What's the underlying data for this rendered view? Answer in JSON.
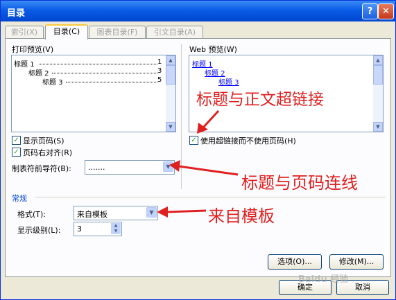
{
  "window": {
    "title": "目录",
    "help": "?",
    "close": "✕"
  },
  "tabs": [
    {
      "label": "索引(X)"
    },
    {
      "label": "目录(C)"
    },
    {
      "label": "图表目录(F)"
    },
    {
      "label": "引文目录(A)"
    }
  ],
  "print_preview": {
    "label": "打印预览(V)",
    "lines": [
      "标题 1",
      "标题 2",
      "标题 3"
    ],
    "pages": [
      "1",
      "3",
      "5"
    ]
  },
  "web_preview": {
    "label": "Web 预览(W)",
    "links": [
      "标题 1",
      "标题 2",
      "标题 3"
    ]
  },
  "options": {
    "show_page_numbers": "显示页码(S)",
    "right_align": "页码右对齐(R)",
    "tab_leader_label": "制表符前导符(B):",
    "tab_leader_value": ".......",
    "use_hyperlinks": "使用超链接而不使用页码(H)"
  },
  "general": {
    "group_label": "常规",
    "format_label": "格式(T):",
    "format_value": "来自模板",
    "levels_label": "显示级别(L):",
    "levels_value": "3"
  },
  "buttons": {
    "options": "选项(O)...",
    "modify": "修改(M)...",
    "ok": "确定",
    "cancel": "取消"
  },
  "annotations": {
    "hyperlink": "标题与正文超链接",
    "leader": "标题与页码连线",
    "template": "来自模板"
  },
  "colors": {
    "annotation": "#e02020",
    "titlebar": "#0a5ce6",
    "link": "#0000ff"
  },
  "watermark": "Baidu 经验"
}
